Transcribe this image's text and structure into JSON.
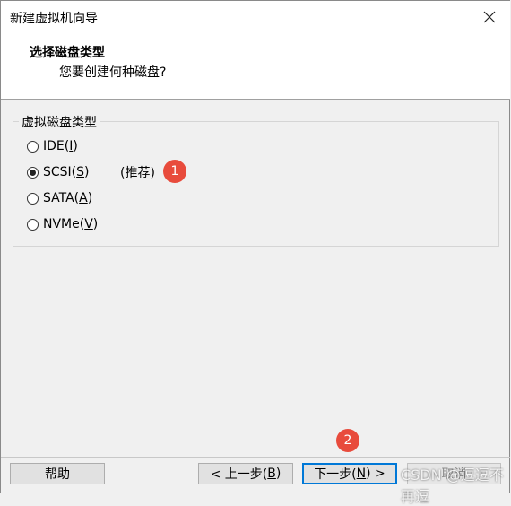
{
  "window": {
    "title": "新建虚拟机向导"
  },
  "header": {
    "title": "选择磁盘类型",
    "subtitle": "您要创建何种磁盘?"
  },
  "group": {
    "label": "虚拟磁盘类型",
    "options": [
      {
        "prefix": "IDE(",
        "key": "I",
        "suffix": ")",
        "checked": false
      },
      {
        "prefix": "SCSI(",
        "key": "S",
        "suffix": ")",
        "checked": true
      },
      {
        "prefix": "SATA(",
        "key": "A",
        "suffix": ")",
        "checked": false
      },
      {
        "prefix": "NVMe(",
        "key": "V",
        "suffix": ")",
        "checked": false
      }
    ],
    "recommend": "(推荐)"
  },
  "badges": [
    "1",
    "2"
  ],
  "buttons": {
    "help": "帮助",
    "back_prefix": "< 上一步(",
    "back_key": "B",
    "back_suffix": ")",
    "next_prefix": "下一步(",
    "next_key": "N",
    "next_suffix": ") >",
    "cancel": "取消"
  },
  "watermark": "CSDN @逗逗不再逗"
}
